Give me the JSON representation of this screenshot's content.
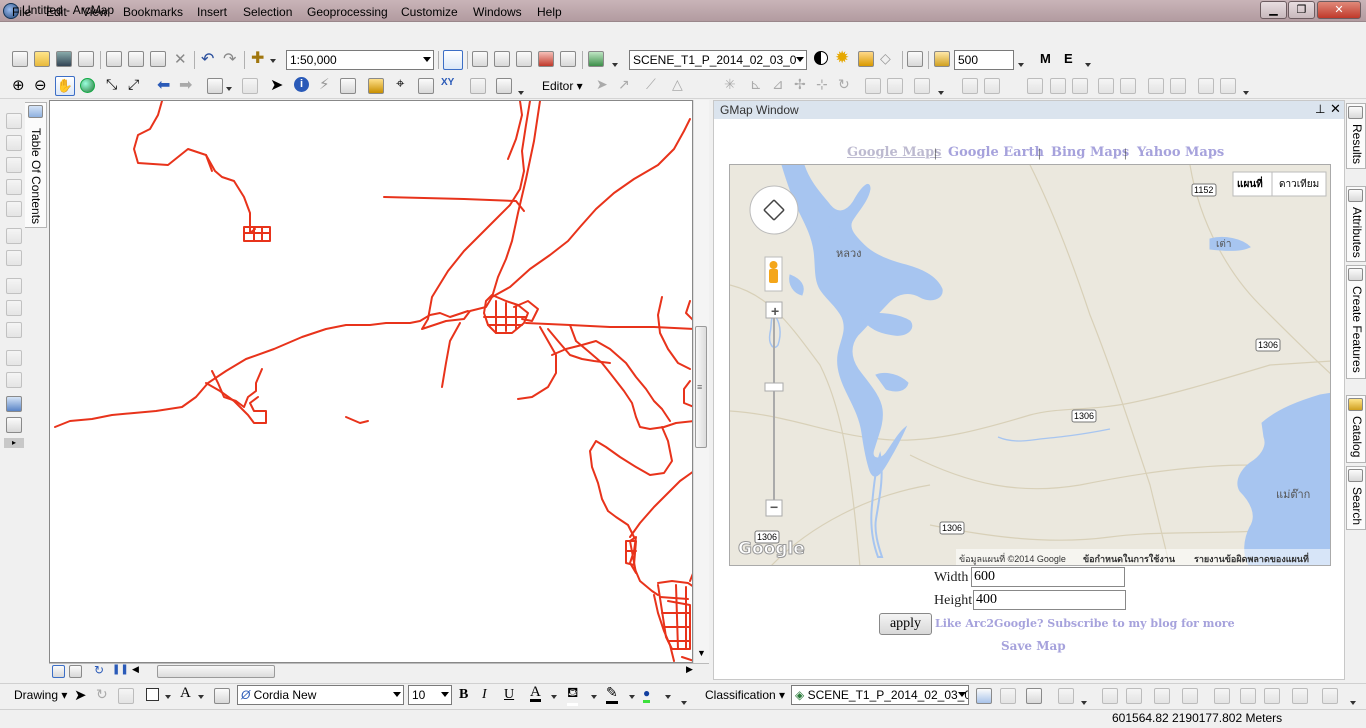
{
  "window": {
    "title": "Untitled - ArcMap",
    "close_glyph": "✕",
    "max_glyph": "❐",
    "min_glyph": "▁"
  },
  "menu": [
    "File",
    "Edit",
    "View",
    "Bookmarks",
    "Insert",
    "Selection",
    "Geoprocessing",
    "Customize",
    "Windows",
    "Help"
  ],
  "standard_toolbar": {
    "scale": "1:50,000",
    "layer": "SCENE_T1_P_2014_02_03_0",
    "zoom_value": "500",
    "m_label": "M",
    "e_label": "E"
  },
  "editor_toolbar": {
    "editor_label": "Editor ▾"
  },
  "toc": {
    "label": "Table Of Contents"
  },
  "gmap": {
    "title": "GMap Window",
    "pin_glyph": "⊥",
    "close_glyph": "✕",
    "links": [
      "Google Maps",
      "Google Earth",
      "Bing Maps",
      "Yahoo Maps"
    ],
    "pipe": "|",
    "map": {
      "type_buttons": [
        "แผนที่",
        "ดาวเทียม"
      ],
      "place_labels": [
        "หลวง",
        "เต่า",
        "แม่ต๊าก"
      ],
      "road_shields": [
        "1152",
        "1306",
        "1306",
        "1306",
        "1306"
      ],
      "attribution": "ข้อมูลแผนที่ ©2014 Google",
      "terms": "ข้อกำหนดในการใช้งาน",
      "report": "รายงานข้อผิดพลาดของแผนที่",
      "logo": "Google",
      "zoom_in": "+",
      "zoom_out": "−"
    },
    "width_label": "Width",
    "width_value": "600",
    "height_label": "Height",
    "height_value": "400",
    "apply_label": "apply",
    "blog_text": "Like Arc2Google? Subscribe to my blog for more",
    "save_label": "Save Map"
  },
  "right_tabs": [
    "Results",
    "Attributes",
    "Create Features",
    "Catalog",
    "Search"
  ],
  "draw_toolbar": {
    "drawing_label": "Drawing ▾",
    "font": "Cordia New",
    "font_size": "10",
    "bold": "B",
    "italic": "I",
    "underline": "U",
    "font_color_glyph": "A",
    "classification_label": "Classification ▾",
    "layer": "SCENE_T1_P_2014_02_03_0"
  },
  "status": {
    "coordinates": "601564.82  2190177.802 Meters"
  },
  "colors": {
    "road": "#e8331b",
    "water": "#a7c5f0",
    "link": "#a6a2dc"
  }
}
